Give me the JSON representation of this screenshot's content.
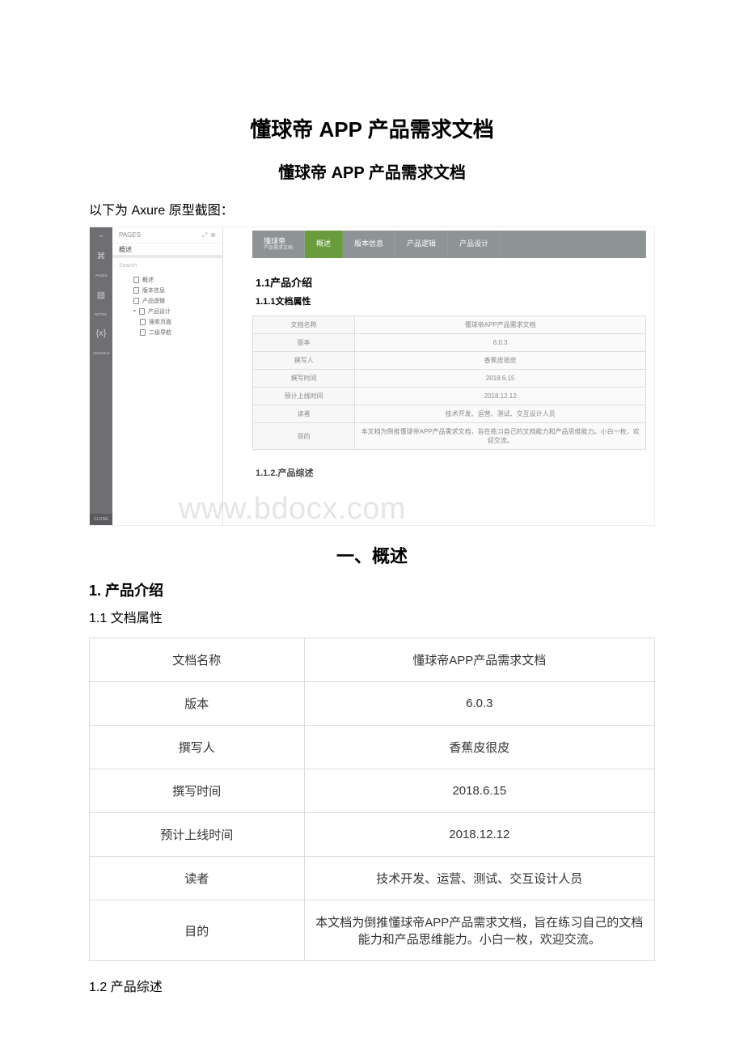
{
  "title_main": "懂球帝 APP 产品需求文档",
  "title_sub": "懂球帝 APP 产品需求文档",
  "caption": "以下为 Axure 原型截图：",
  "axure": {
    "sidebar": {
      "chevron": "⌄",
      "tags": {
        "pages": "PAGES",
        "notes": "NOTES",
        "console": "CONSOLE",
        "close": "CLOSE"
      },
      "icons": {
        "sitemap": "⌘",
        "doc": "▤",
        "fx": "{x}"
      },
      "panel": {
        "pages_label": "PAGES",
        "active_page": "概述",
        "icon_expand": "⤢",
        "icon_add": "⊕",
        "search_placeholder": "Search",
        "tree": [
          {
            "label": "概述",
            "depth": 1
          },
          {
            "label": "版本信息",
            "depth": 1
          },
          {
            "label": "产品逻辑",
            "depth": 1
          },
          {
            "label": "产品设计",
            "depth": 1,
            "has_children": true
          },
          {
            "label": "搜索页面",
            "depth": 2
          },
          {
            "label": "二级导航",
            "depth": 2
          }
        ]
      }
    },
    "main": {
      "nav": [
        {
          "t1": "懂球帝",
          "t2": "产品需求文档",
          "active": false
        },
        {
          "t1": "概述",
          "active": true
        },
        {
          "t1": "版本信息",
          "active": false
        },
        {
          "t1": "产品逻辑",
          "active": false
        },
        {
          "t1": "产品设计",
          "active": false
        }
      ],
      "h1": "1.1产品介绍",
      "h2": "1.1.1文档属性",
      "rows": [
        {
          "k": "文档名称",
          "v": "懂球帝APP产品需求文档"
        },
        {
          "k": "版本",
          "v": "6.0.3"
        },
        {
          "k": "撰写人",
          "v": "香蕉皮很皮"
        },
        {
          "k": "撰写时间",
          "v": "2018.6.15"
        },
        {
          "k": "预计上线时间",
          "v": "2018.12.12"
        },
        {
          "k": "读者",
          "v": "技术开发、运营、测试、交互设计人员"
        },
        {
          "k": "目的",
          "v": "本文档为倒推懂球帝APP产品需求文档，旨在练习自己的文档能力和产品思维能力。小白一枚，欢迎交流。"
        }
      ],
      "h3": "1.1.2.产品综述"
    },
    "watermark": "www.bdocx.com"
  },
  "section": {
    "head": "一、概述",
    "h2": "1. 产品介绍",
    "h3a": "1.1 文档属性",
    "rows": [
      {
        "k": "文档名称",
        "v": "懂球帝APP产品需求文档"
      },
      {
        "k": "版本",
        "v": "6.0.3"
      },
      {
        "k": "撰写人",
        "v": "香蕉皮很皮"
      },
      {
        "k": "撰写时间",
        "v": "2018.6.15"
      },
      {
        "k": "预计上线时间",
        "v": "2018.12.12"
      },
      {
        "k": "读者",
        "v": "技术开发、运营、测试、交互设计人员"
      },
      {
        "k": "目的",
        "v": "本文档为倒推懂球帝APP产品需求文档，旨在练习自己的文档能力和产品思维能力。小白一枚，欢迎交流。"
      }
    ],
    "h3b": "1.2 产品综述"
  }
}
